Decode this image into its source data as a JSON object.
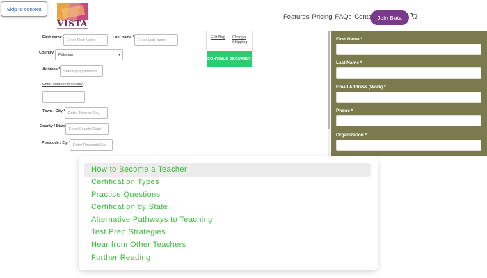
{
  "skip_link": "Skip to content",
  "brand": {
    "name": "VISTA"
  },
  "nav": {
    "links": [
      "Features",
      "Pricing",
      "FAQs",
      "Contact"
    ],
    "join_label": "Join Beta",
    "join_color": "#7a3a8c"
  },
  "checkout": {
    "first_name_label": "First name *",
    "first_name_placeholder": "Enter First Name",
    "last_name_label": "Last name *",
    "last_name_placeholder": "Enter Last Name",
    "country_label": "Country",
    "country_value": "Pakistan",
    "address_label": "Address *",
    "address_placeholder": "Start typing address",
    "manual_address_link": "Enter address manually",
    "town_label": "Town / City *",
    "town_placeholder": "Enter Town or City",
    "county_label": "County / State",
    "county_placeholder": "Enter County/State",
    "postcode_label": "Postcode / Zip *",
    "postcode_placeholder": "Enter Postcode/Zip",
    "mini_links": [
      "Edit Bag",
      "Change Shipping"
    ],
    "continue_label": "CONTINUE SECURELY",
    "continue_color": "#2ecc71"
  },
  "signup_panel": {
    "bg_color": "#7b7a4d",
    "fields": [
      {
        "label": "First Name *"
      },
      {
        "label": "Last Name *"
      },
      {
        "label": "Email Address (Work) *"
      },
      {
        "label": "Phone *"
      },
      {
        "label": "Organization *"
      }
    ]
  },
  "menu": {
    "link_color": "#3cbb3c",
    "items": [
      "How to Become a Teacher",
      "Certification Types",
      "Practice Questions",
      "Certification by State",
      "Alternative Pathways to Teaching",
      "Test Prep Strategies",
      "Hear from Other Teachers",
      "Further Reading"
    ]
  }
}
